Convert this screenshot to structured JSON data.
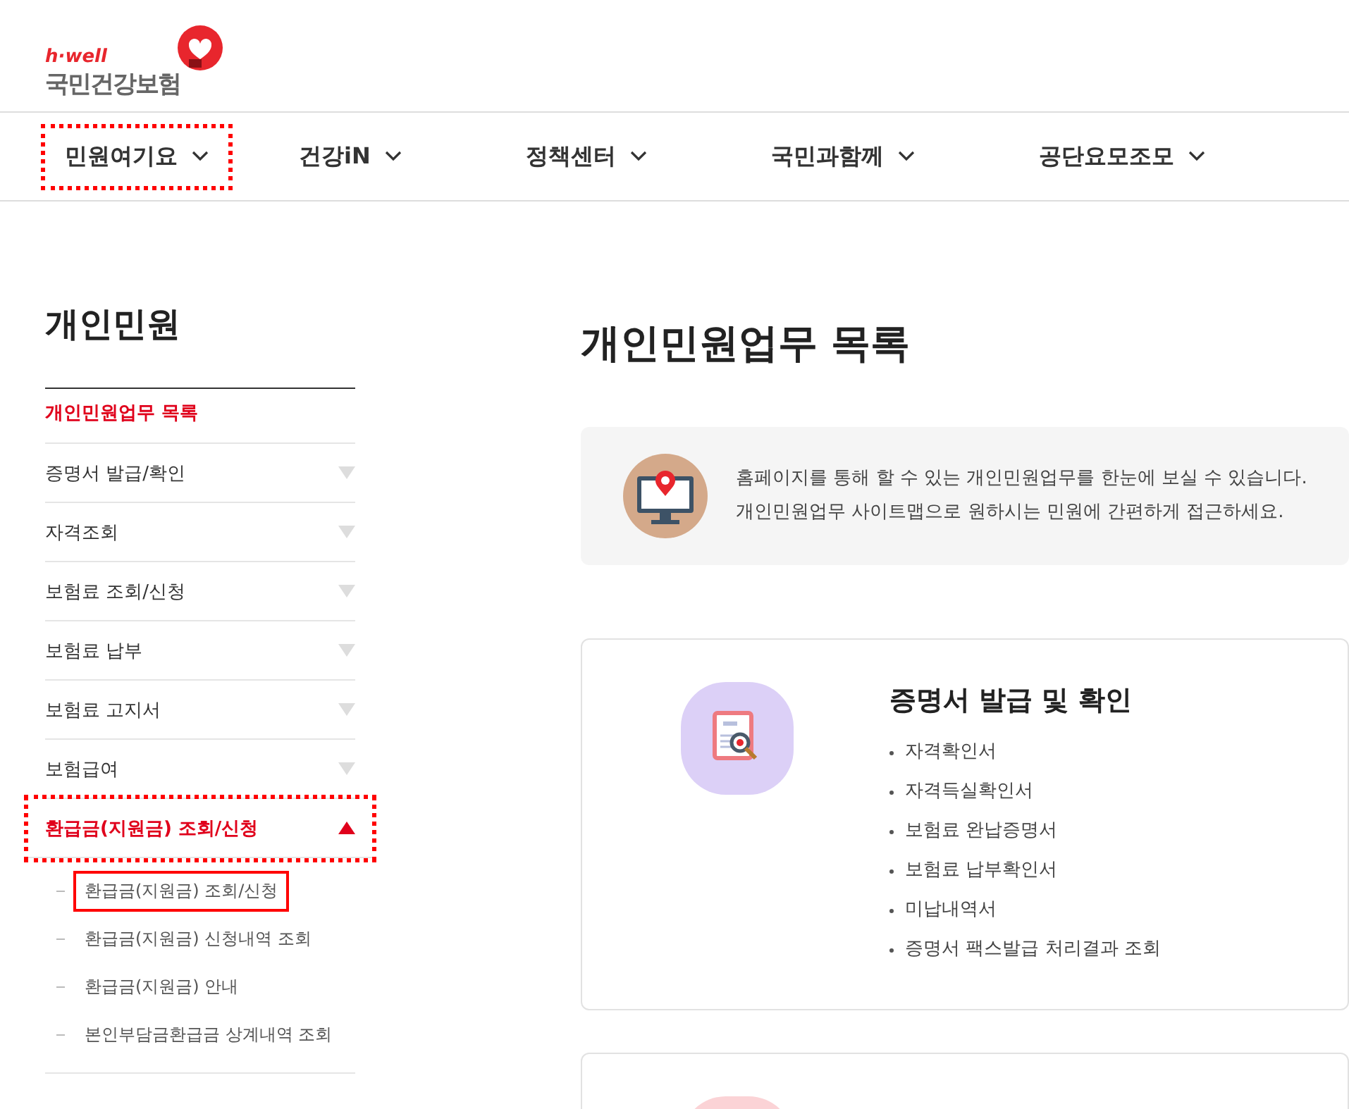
{
  "logo": {
    "tagline": "h·well",
    "name": "국민건강보험"
  },
  "nav": [
    {
      "label": "민원여기요",
      "highlighted": true
    },
    {
      "label": "건강iN",
      "highlighted": false
    },
    {
      "label": "정책센터",
      "highlighted": false
    },
    {
      "label": "국민과함께",
      "highlighted": false
    },
    {
      "label": "공단요모조모",
      "highlighted": false
    }
  ],
  "sidebar": {
    "title": "개인민원",
    "items": [
      {
        "label": "개인민원업무 목록",
        "kind": "link",
        "active": true,
        "highlighted": false
      },
      {
        "label": "증명서 발급/확인",
        "kind": "group",
        "active": false,
        "expanded": false,
        "highlighted": false
      },
      {
        "label": "자격조회",
        "kind": "group",
        "active": false,
        "expanded": false,
        "highlighted": false
      },
      {
        "label": "보험료 조회/신청",
        "kind": "group",
        "active": false,
        "expanded": false,
        "highlighted": false
      },
      {
        "label": "보험료 납부",
        "kind": "group",
        "active": false,
        "expanded": false,
        "highlighted": false
      },
      {
        "label": "보험료 고지서",
        "kind": "group",
        "active": false,
        "expanded": false,
        "highlighted": false
      },
      {
        "label": "보험급여",
        "kind": "group",
        "active": false,
        "expanded": false,
        "highlighted": false
      },
      {
        "label": "환급금(지원금) 조회/신청",
        "kind": "group",
        "active": true,
        "expanded": true,
        "highlighted": true,
        "children": [
          {
            "label": "환급금(지원금) 조회/신청",
            "highlighted": true
          },
          {
            "label": "환급금(지원금) 신청내역 조회",
            "highlighted": false
          },
          {
            "label": "환급금(지원금) 안내",
            "highlighted": false
          },
          {
            "label": "본인부담금환급금 상계내역 조회",
            "highlighted": false
          }
        ]
      }
    ]
  },
  "page_title": "개인민원업무 목록",
  "intro": [
    "홈페이지를 통해 할 수 있는 개인민원업무를 한눈에 보실 수 있습니다.",
    "개인민원업무 사이트맵으로 원하시는 민원에 간편하게 접근하세요."
  ],
  "cards": [
    {
      "title": "증명서 발급 및 확인",
      "color": "#dcd0f7",
      "items": [
        "자격확인서",
        "자격득실확인서",
        "보험료 완납증명서",
        "보험료 납부확인서",
        "미납내역서",
        "증명서 팩스발급 처리결과 조회"
      ]
    },
    {
      "color": "#fbd3d6"
    }
  ]
}
